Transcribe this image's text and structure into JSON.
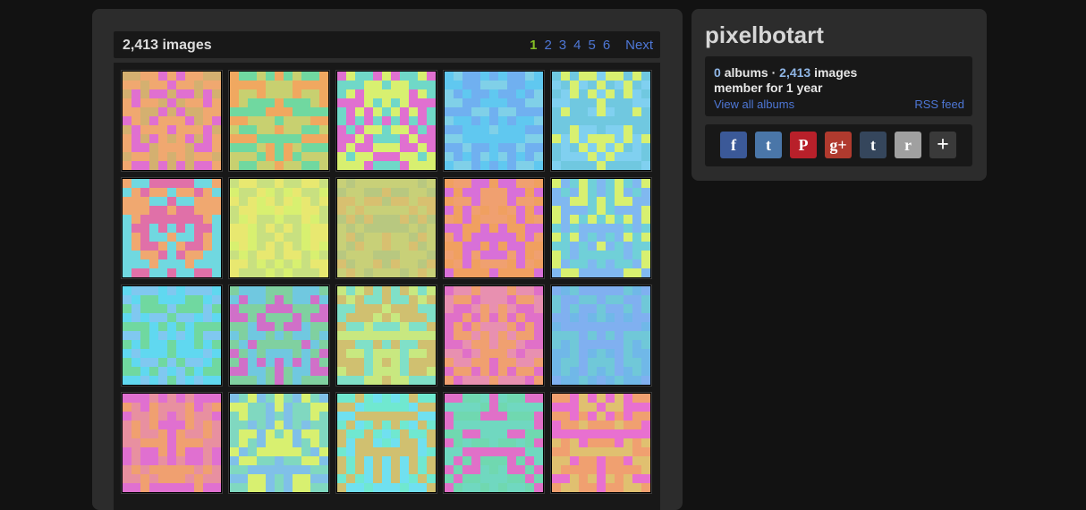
{
  "gallery": {
    "count_label": "2,413 images",
    "pages": [
      "1",
      "2",
      "3",
      "4",
      "5",
      "6"
    ],
    "current_page": "1",
    "next_label": "Next",
    "thumbnails": [
      {
        "colors": [
          "#e070d0",
          "#d4b070",
          "#f0a870"
        ]
      },
      {
        "colors": [
          "#70d8a0",
          "#f0a860",
          "#c8d070"
        ]
      },
      {
        "colors": [
          "#e070d0",
          "#70d8c8",
          "#d8f070"
        ]
      },
      {
        "colors": [
          "#60c8f0",
          "#70b0f0",
          "#80d0e8"
        ]
      },
      {
        "colors": [
          "#80d0f0",
          "#d8f070",
          "#70c8e0"
        ]
      },
      {
        "colors": [
          "#70d8e0",
          "#e070a8",
          "#f0a870"
        ]
      },
      {
        "colors": [
          "#e8e870",
          "#c8e080",
          "#d8f070"
        ]
      },
      {
        "colors": [
          "#d8c070",
          "#c8d078",
          "#b8c880"
        ]
      },
      {
        "colors": [
          "#f0a060",
          "#d870d8",
          "#f0a070"
        ]
      },
      {
        "colors": [
          "#d8f070",
          "#80b8f0",
          "#70d0d8"
        ]
      },
      {
        "colors": [
          "#80c8f0",
          "#70d8a0",
          "#60d8f0"
        ]
      },
      {
        "colors": [
          "#70c8e0",
          "#d070c8",
          "#80d0a0"
        ]
      },
      {
        "colors": [
          "#d0c070",
          "#c8e880",
          "#80e0c8"
        ]
      },
      {
        "colors": [
          "#f0a070",
          "#e070c8",
          "#e890b0"
        ]
      },
      {
        "colors": [
          "#80b0f0",
          "#70b8e8",
          "#70c8d8"
        ]
      },
      {
        "colors": [
          "#e070d0",
          "#f0a070",
          "#e890a0"
        ]
      },
      {
        "colors": [
          "#80d8c0",
          "#d8f070",
          "#80c0e8"
        ]
      },
      {
        "colors": [
          "#70e0f0",
          "#d0c070",
          "#70e8d0"
        ]
      },
      {
        "colors": [
          "#70d8c0",
          "#e070c8",
          "#70d8b0"
        ]
      },
      {
        "colors": [
          "#e870d0",
          "#f0a070",
          "#e0c070"
        ]
      }
    ]
  },
  "profile": {
    "username": "pixelbotart",
    "albums_count": "0",
    "albums_label": "albums",
    "separator": " · ",
    "images_count": "2,413",
    "images_label": "images",
    "member_since": "member for 1 year",
    "view_all_label": "View all albums",
    "rss_label": "RSS feed"
  },
  "share": [
    {
      "name": "facebook-icon",
      "color": "#3b5998",
      "glyph": "f"
    },
    {
      "name": "twitter-icon",
      "color": "#4a76a8",
      "glyph": "t"
    },
    {
      "name": "pinterest-icon",
      "color": "#b8202a",
      "glyph": "P"
    },
    {
      "name": "googleplus-icon",
      "color": "#b03a2e",
      "glyph": "g+"
    },
    {
      "name": "tumblr-icon",
      "color": "#35465c",
      "glyph": "t"
    },
    {
      "name": "reddit-icon",
      "color": "#a0a0a0",
      "glyph": "r"
    },
    {
      "name": "add-share-icon",
      "color": "#3a3a3a",
      "glyph": "+"
    }
  ]
}
